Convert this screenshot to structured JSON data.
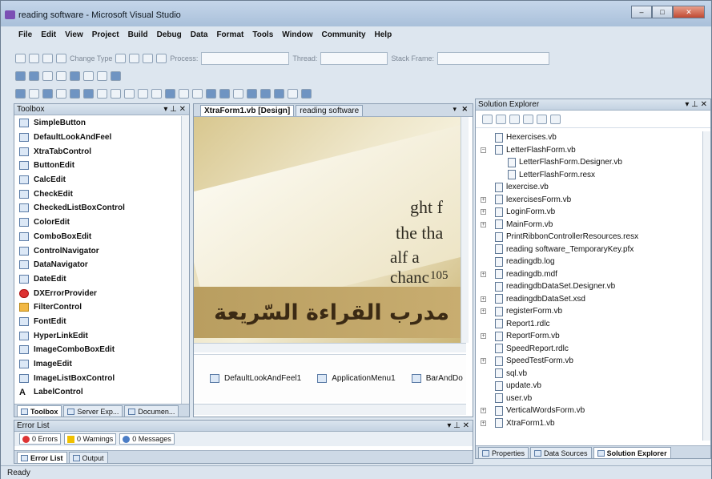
{
  "window": {
    "title": "reading software - Microsoft Visual Studio",
    "min": "–",
    "max": "□",
    "close": "✕"
  },
  "menu": [
    "File",
    "Edit",
    "View",
    "Project",
    "Build",
    "Debug",
    "Data",
    "Format",
    "Tools",
    "Window",
    "Community",
    "Help"
  ],
  "toolbar": {
    "change_type": "Change Type",
    "process_label": "Process:",
    "thread_label": "Thread:",
    "stack_frame_label": "Stack Frame:"
  },
  "toolbox": {
    "title": "Toolbox",
    "buttons": "▾ ⊥ ✕",
    "items": [
      "SimpleButton",
      "DefaultLookAndFeel",
      "XtraTabControl",
      "ButtonEdit",
      "CalcEdit",
      "CheckEdit",
      "CheckedListBoxControl",
      "ColorEdit",
      "ComboBoxEdit",
      "ControlNavigator",
      "DataNavigator",
      "DateEdit",
      "DXErrorProvider",
      "FilterControl",
      "FontEdit",
      "HyperLinkEdit",
      "ImageComboBoxEdit",
      "ImageEdit",
      "ImageListBoxControl",
      "LabelControl"
    ],
    "tabs": [
      "Toolbox",
      "Server Exp...",
      "Documen..."
    ]
  },
  "editor": {
    "tabs": [
      "XtraForm1.vb [Design]",
      "reading software"
    ],
    "close": "✕",
    "arrow": "▾",
    "book_lines": [
      "ght f",
      "the tha",
      "alf a chanc",
      "105"
    ],
    "banner": "مدرب القراءة السّريعة",
    "components": [
      "DefaultLookAndFeel1",
      "ApplicationMenu1",
      "BarAndDo"
    ]
  },
  "solution": {
    "title": "Solution Explorer",
    "buttons": "▾ ⊥ ✕",
    "items": [
      {
        "name": "Hexercises.vb",
        "indent": 0,
        "exp": ""
      },
      {
        "name": "LetterFlashForm.vb",
        "indent": 0,
        "exp": "−"
      },
      {
        "name": "LetterFlashForm.Designer.vb",
        "indent": 1,
        "exp": ""
      },
      {
        "name": "LetterFlashForm.resx",
        "indent": 1,
        "exp": ""
      },
      {
        "name": "lexercise.vb",
        "indent": 0,
        "exp": ""
      },
      {
        "name": "lexercisesForm.vb",
        "indent": 0,
        "exp": "+"
      },
      {
        "name": "LoginForm.vb",
        "indent": 0,
        "exp": "+"
      },
      {
        "name": "MainForm.vb",
        "indent": 0,
        "exp": "+"
      },
      {
        "name": "PrintRibbonControllerResources.resx",
        "indent": 0,
        "exp": ""
      },
      {
        "name": "reading software_TemporaryKey.pfx",
        "indent": 0,
        "exp": ""
      },
      {
        "name": "readingdb.log",
        "indent": 0,
        "exp": ""
      },
      {
        "name": "readingdb.mdf",
        "indent": 0,
        "exp": "+"
      },
      {
        "name": "readingdbDataSet.Designer.vb",
        "indent": 0,
        "exp": ""
      },
      {
        "name": "readingdbDataSet.xsd",
        "indent": 0,
        "exp": "+"
      },
      {
        "name": "registerForm.vb",
        "indent": 0,
        "exp": "+"
      },
      {
        "name": "Report1.rdlc",
        "indent": 0,
        "exp": ""
      },
      {
        "name": "ReportForm.vb",
        "indent": 0,
        "exp": "+"
      },
      {
        "name": "SpeedReport.rdlc",
        "indent": 0,
        "exp": ""
      },
      {
        "name": "SpeedTestForm.vb",
        "indent": 0,
        "exp": "+"
      },
      {
        "name": "sql.vb",
        "indent": 0,
        "exp": ""
      },
      {
        "name": "update.vb",
        "indent": 0,
        "exp": ""
      },
      {
        "name": "user.vb",
        "indent": 0,
        "exp": ""
      },
      {
        "name": "VerticalWordsForm.vb",
        "indent": 0,
        "exp": "+"
      },
      {
        "name": "XtraForm1.vb",
        "indent": 0,
        "exp": "+"
      }
    ],
    "tabs": [
      "Properties",
      "Data Sources",
      "Solution Explorer"
    ]
  },
  "errorlist": {
    "title": "Error List",
    "buttons": "▾ ⊥ ✕",
    "filters": [
      "0 Errors",
      "0 Warnings",
      "0 Messages"
    ],
    "tabs": [
      "Error List",
      "Output"
    ]
  },
  "status": "Ready"
}
